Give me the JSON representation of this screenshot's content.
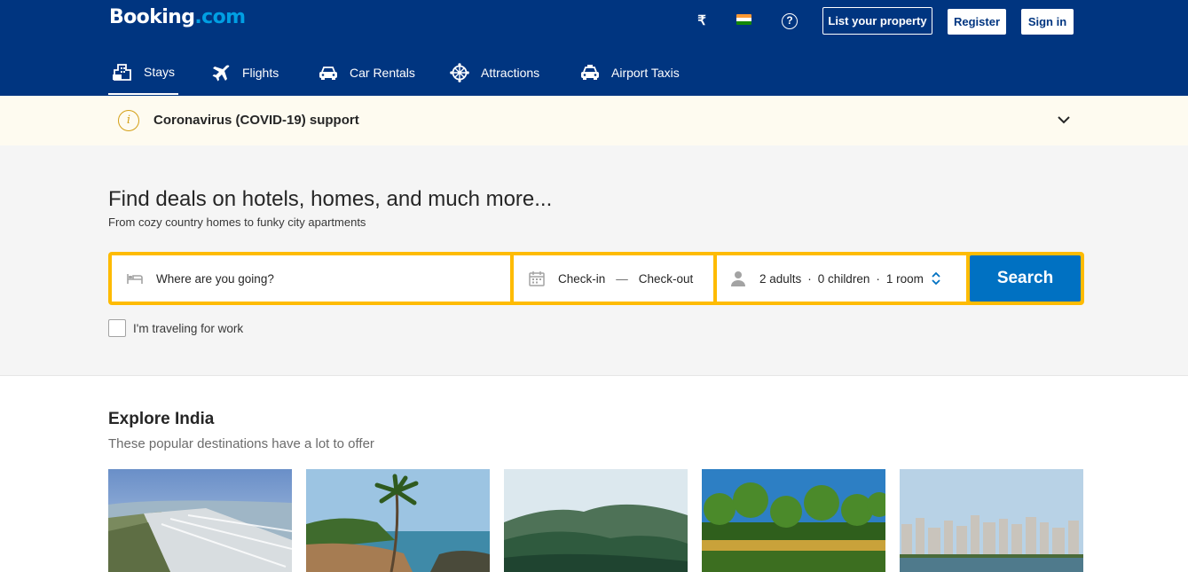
{
  "header": {
    "logo_main": "Booking",
    "logo_suffix": ".com",
    "currency_symbol": "₹",
    "help_symbol": "?",
    "list_property_label": "List your property",
    "register_label": "Register",
    "signin_label": "Sign in"
  },
  "nav": {
    "items": [
      {
        "label": "Stays",
        "icon": "bed-building-icon"
      },
      {
        "label": "Flights",
        "icon": "airplane-icon"
      },
      {
        "label": "Car Rentals",
        "icon": "car-icon"
      },
      {
        "label": "Attractions",
        "icon": "ferris-wheel-icon"
      },
      {
        "label": "Airport Taxis",
        "icon": "taxi-icon"
      }
    ]
  },
  "covid": {
    "icon_char": "i",
    "text": "Coronavirus (COVID-19) support"
  },
  "hero": {
    "title": "Find deals on hotels, homes, and much more...",
    "subtitle": "From cozy country homes to funky city apartments"
  },
  "search": {
    "destination_placeholder": "Where are you going?",
    "checkin_label": "Check-in",
    "dash": "—",
    "checkout_label": "Check-out",
    "adults": "2 adults",
    "children": "0 children",
    "rooms": "1 room",
    "sep": "·",
    "search_label": "Search",
    "work_label": "I'm traveling for work"
  },
  "explore": {
    "title": "Explore India",
    "subtitle": "These popular destinations have a lot to offer"
  },
  "colors": {
    "brand_blue": "#003580",
    "search_yellow": "#febb02",
    "button_blue": "#0071c2",
    "logo_accent": "#009fe3",
    "covid_banner": "#fefbf0"
  }
}
